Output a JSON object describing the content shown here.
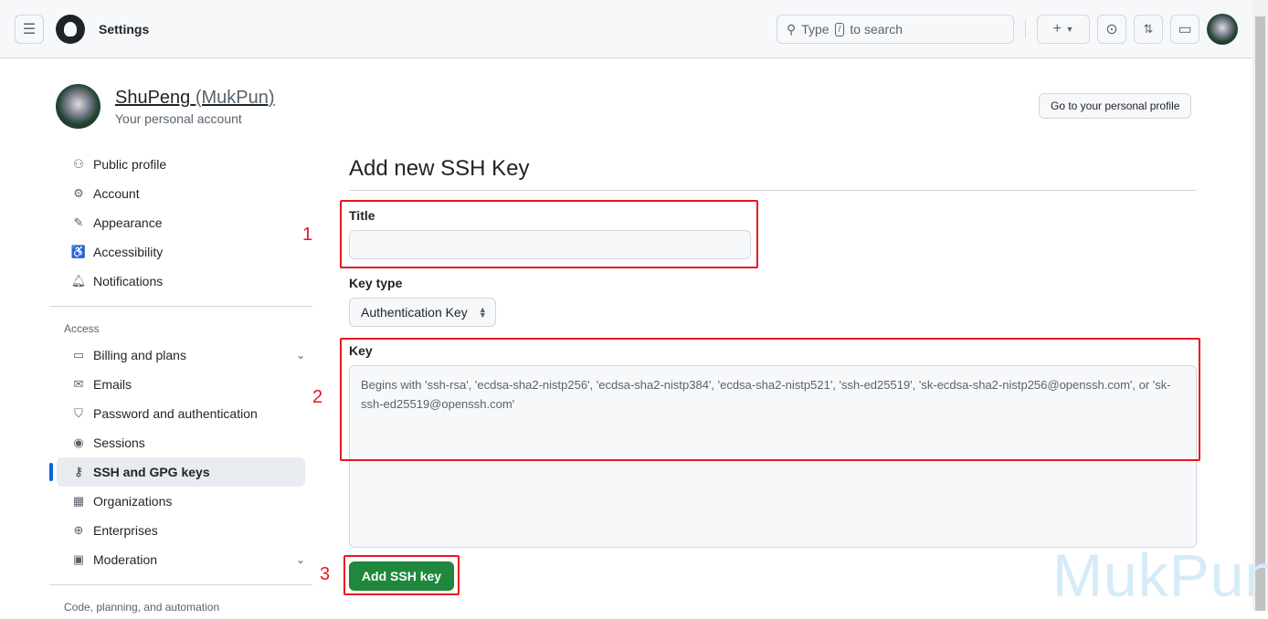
{
  "header": {
    "title": "Settings",
    "search_prefix": "Type",
    "search_key": "/",
    "search_suffix": "to search"
  },
  "profile": {
    "name": "ShuPeng",
    "login": "(MukPun)",
    "subtitle": "Your personal account",
    "go_profile": "Go to your personal profile"
  },
  "sidebar": {
    "group1": [
      {
        "label": "Public profile",
        "icon": "person-icon"
      },
      {
        "label": "Account",
        "icon": "gear-icon"
      },
      {
        "label": "Appearance",
        "icon": "paintbrush-icon"
      },
      {
        "label": "Accessibility",
        "icon": "accessibility-icon"
      },
      {
        "label": "Notifications",
        "icon": "bell-icon"
      }
    ],
    "access_title": "Access",
    "group2": [
      {
        "label": "Billing and plans",
        "icon": "credit-card-icon"
      },
      {
        "label": "Emails",
        "icon": "mail-icon"
      },
      {
        "label": "Password and authentication",
        "icon": "shield-icon"
      },
      {
        "label": "Sessions",
        "icon": "broadcast-icon"
      },
      {
        "label": "SSH and GPG keys",
        "icon": "key-icon"
      },
      {
        "label": "Organizations",
        "icon": "organization-icon"
      },
      {
        "label": "Enterprises",
        "icon": "globe-icon"
      },
      {
        "label": "Moderation",
        "icon": "report-icon"
      }
    ],
    "code_title": "Code, planning, and automation"
  },
  "form": {
    "heading": "Add new SSH Key",
    "title_label": "Title",
    "title_value": "",
    "keytype_label": "Key type",
    "keytype_value": "Authentication Key",
    "key_label": "Key",
    "key_placeholder": "Begins with 'ssh-rsa', 'ecdsa-sha2-nistp256', 'ecdsa-sha2-nistp384', 'ecdsa-sha2-nistp521', 'ssh-ed25519', 'sk-ecdsa-sha2-nistp256@openssh.com', or 'sk-ssh-ed25519@openssh.com'",
    "submit": "Add SSH key"
  },
  "annotations": {
    "n1": "1",
    "n2": "2",
    "n3": "3",
    "color": "#e8161f"
  },
  "watermark": "MukPun",
  "colors": {
    "primary_button": "#1f883d",
    "active_indicator": "#0969da"
  }
}
